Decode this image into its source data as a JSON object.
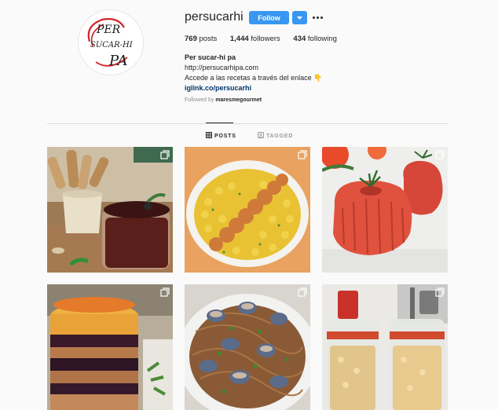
{
  "profile": {
    "username": "persucarhi",
    "follow_label": "Follow",
    "stats": {
      "posts_value": "769",
      "posts_label": "posts",
      "followers_value": "1,444",
      "followers_label": "followers",
      "following_value": "434",
      "following_label": "following"
    },
    "bio": {
      "name": "Per sucar-hi pa",
      "website": "http://persucarhipa.com",
      "description": "Accede a las recetas a través del enlace 👇",
      "link": "iglink.co/persucarhi"
    },
    "followed_by_prefix": "Followed by",
    "followed_by_user": "maresmegourmet"
  },
  "avatar": {
    "line1": "PER",
    "line2": "SUCAR-HI",
    "line3": "PA",
    "accent_color": "#d2232a"
  },
  "tabs": {
    "posts_label": "POSTS",
    "tagged_label": "TAGGED"
  },
  "colors": {
    "accent": "#3897f0",
    "link": "#003569",
    "muted": "#8e8e8e"
  },
  "posts": [
    {
      "icon": "carousel-icon"
    },
    {
      "icon": "carousel-icon"
    },
    {
      "icon": "carousel-icon"
    },
    {
      "icon": "carousel-icon"
    },
    {
      "icon": "carousel-icon"
    },
    {
      "icon": "carousel-icon"
    }
  ]
}
